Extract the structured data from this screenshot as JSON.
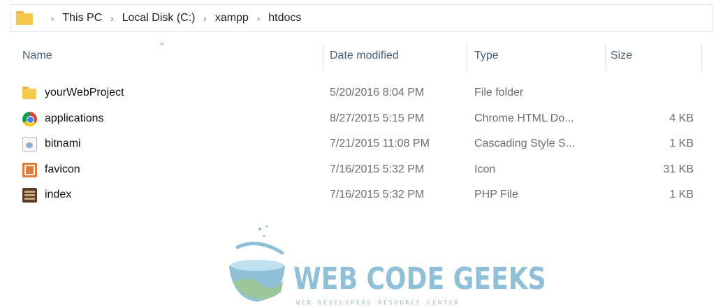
{
  "address_bar": {
    "icon": "folder-icon",
    "crumbs": [
      "This PC",
      "Local Disk (C:)",
      "xampp",
      "htdocs"
    ]
  },
  "columns": {
    "name": "Name",
    "date_modified": "Date modified",
    "type": "Type",
    "size": "Size",
    "sort_indicator": "^"
  },
  "files": [
    {
      "icon": "folder-icon",
      "name": "yourWebProject",
      "date": "5/20/2016 8:04 PM",
      "type": "File folder",
      "size": ""
    },
    {
      "icon": "chrome-html-icon",
      "name": "applications",
      "date": "8/27/2015 5:15 PM",
      "type": "Chrome HTML Do...",
      "size": "4 KB"
    },
    {
      "icon": "css-file-icon",
      "name": "bitnami",
      "date": "7/21/2015 11:08 PM",
      "type": "Cascading Style S...",
      "size": "1 KB"
    },
    {
      "icon": "ico-file-icon",
      "name": "favicon",
      "date": "7/16/2015 5:32 PM",
      "type": "Icon",
      "size": "31 KB"
    },
    {
      "icon": "php-file-icon",
      "name": "index",
      "date": "7/16/2015 5:32 PM",
      "type": "PHP File",
      "size": "1 KB"
    }
  ],
  "watermark": {
    "title": "WEB CODE GEEKS",
    "subtitle": "WEB DEVELOPERS RESOURCE CENTER"
  },
  "colors": {
    "folder": "#f5c94b",
    "header_text": "#4c607a",
    "logo_blue": "#8fc0d8",
    "logo_green": "#9cc79a"
  }
}
